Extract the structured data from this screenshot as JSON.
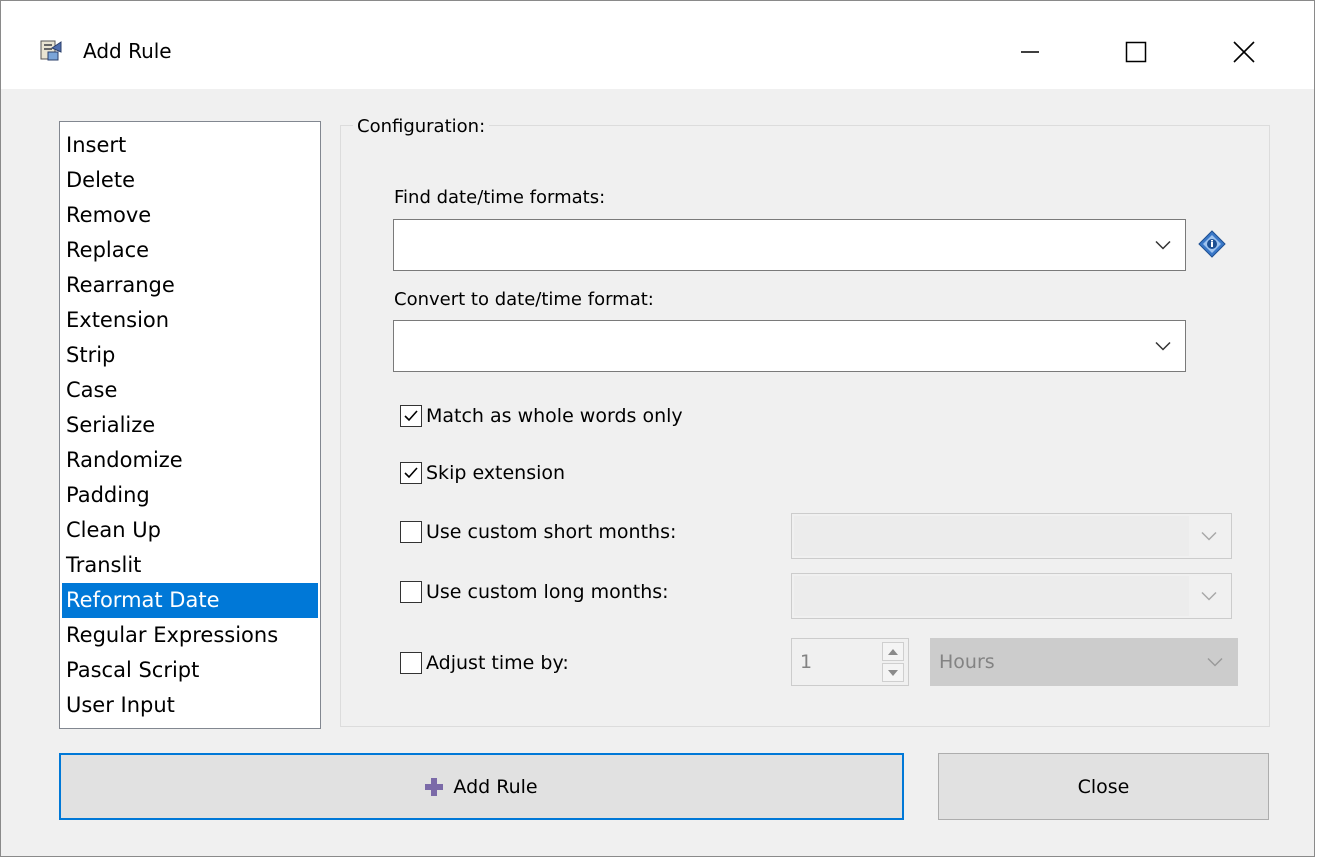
{
  "window": {
    "title": "Add Rule",
    "app_icon": "rule-app-icon",
    "controls": [
      "minimize-icon",
      "maximize-icon",
      "close-icon"
    ]
  },
  "rules": {
    "items": [
      "Insert",
      "Delete",
      "Remove",
      "Replace",
      "Rearrange",
      "Extension",
      "Strip",
      "Case",
      "Serialize",
      "Randomize",
      "Padding",
      "Clean Up",
      "Translit",
      "Reformat Date",
      "Regular Expressions",
      "Pascal Script",
      "User Input"
    ],
    "selected": "Reformat Date"
  },
  "config": {
    "group_label": "Configuration:",
    "find_label": "Find date/time formats:",
    "find_value": "",
    "convert_label": "Convert to date/time format:",
    "convert_value": "",
    "info_icon": "info-icon",
    "match_whole_words": {
      "label": "Match as whole words only",
      "checked": true
    },
    "skip_extension": {
      "label": "Skip extension",
      "checked": true
    },
    "custom_short_months": {
      "label": "Use custom short months:",
      "checked": false,
      "value": ""
    },
    "custom_long_months": {
      "label": "Use custom long months:",
      "checked": false,
      "value": ""
    },
    "adjust_time": {
      "label": "Adjust time by:",
      "checked": false,
      "amount": "1",
      "unit": "Hours"
    }
  },
  "buttons": {
    "add_rule": "Add Rule",
    "close": "Close"
  },
  "colors": {
    "selection": "#0078d7",
    "add_icon": "#7b6aa8",
    "info_icon": "#3a78c8"
  }
}
